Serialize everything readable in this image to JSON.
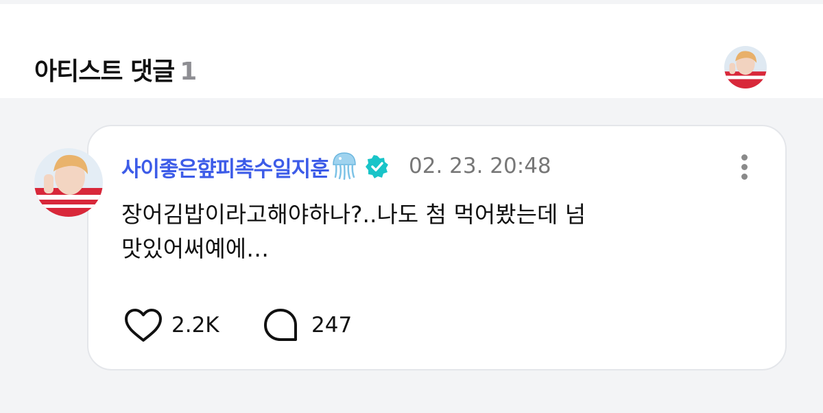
{
  "header": {
    "title": "아티스트 댓글",
    "count": "1",
    "avatar_icon": "artist-avatar"
  },
  "comment": {
    "author": "사이좋은햪피촉수일지훈",
    "author_emoji": "jellyfish-icon",
    "verified_icon": "verified-badge-icon",
    "timestamp": "02. 23. 20:48",
    "more_icon": "more-vertical-icon",
    "text": "장어김밥이라고해야하나?..나도 첨 먹어봤는데 넘\n맛있어써예에…",
    "likes": "2.2K",
    "replies": "247"
  },
  "colors": {
    "author": "#3d5ce8",
    "verified": "#19c4c8",
    "background": "#f3f4f6"
  }
}
